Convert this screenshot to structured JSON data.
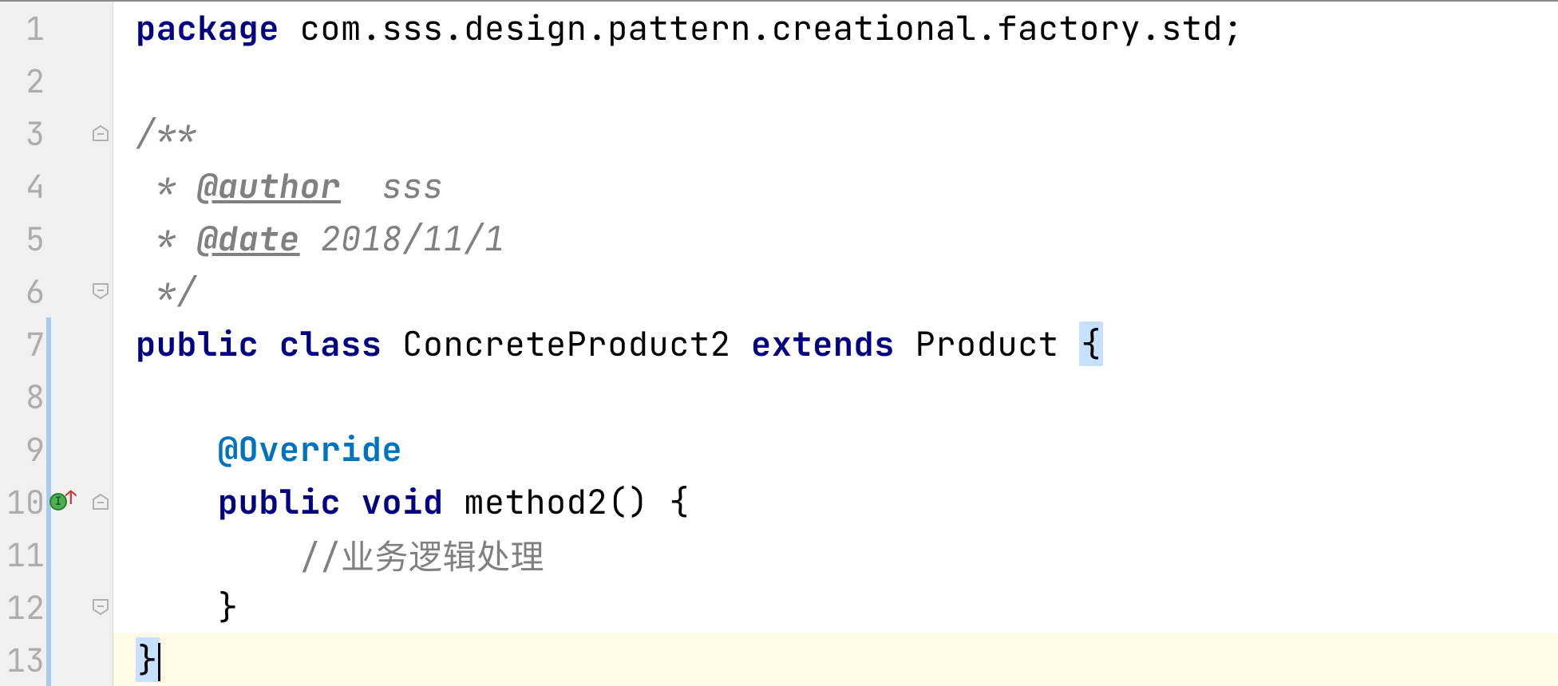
{
  "lines": [
    {
      "num": "1"
    },
    {
      "num": "2"
    },
    {
      "num": "3"
    },
    {
      "num": "4"
    },
    {
      "num": "5"
    },
    {
      "num": "6"
    },
    {
      "num": "7"
    },
    {
      "num": "8"
    },
    {
      "num": "9"
    },
    {
      "num": "10"
    },
    {
      "num": "11"
    },
    {
      "num": "12"
    },
    {
      "num": "13"
    }
  ],
  "code": {
    "l1": {
      "kw_package": "package",
      "rest": " com.sss.design.pattern.creational.factory.std;"
    },
    "l3": {
      "open": "/**"
    },
    "l4": {
      "star": " * ",
      "tag": "@author",
      "val": "  sss"
    },
    "l5": {
      "star": " * ",
      "tag": "@date",
      "val": " 2018/11/1"
    },
    "l6": {
      "close": " */"
    },
    "l7": {
      "kw_public": "public",
      "sp1": " ",
      "kw_class": "class",
      "sp2": " ",
      "name": "ConcreteProduct2",
      "sp3": " ",
      "kw_extends": "extends",
      "sp4": " ",
      "superc": "Product",
      "sp5": " ",
      "brace": "{"
    },
    "l9": {
      "indent": "    ",
      "ann": "@Override"
    },
    "l10": {
      "indent": "    ",
      "kw_public": "public",
      "sp1": " ",
      "kw_void": "void",
      "sp2": " ",
      "rest": "method2() {"
    },
    "l11": {
      "indent": "        ",
      "comment": "//业务逻辑处理"
    },
    "l12": {
      "indent": "    ",
      "brace": "}"
    },
    "l13": {
      "brace": "}"
    }
  }
}
